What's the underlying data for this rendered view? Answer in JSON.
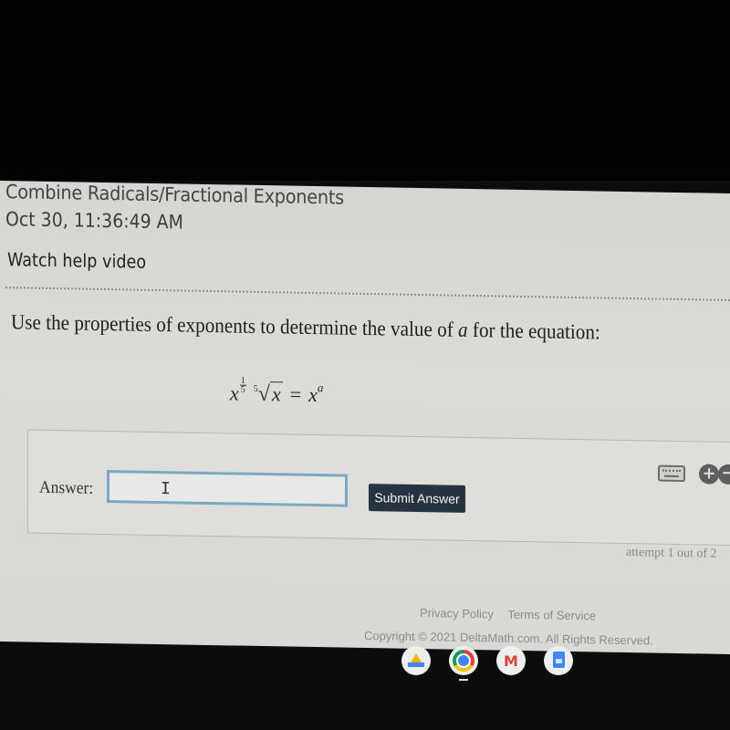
{
  "problem": {
    "topic": "Combine Radicals/Fractional Exponents",
    "timestamp": "Oct 30, 11:36:49 AM",
    "help_link": "Watch help video",
    "question_prefix": "Use the properties of exponents to determine the value of ",
    "question_variable": "a",
    "question_suffix": " for the equation:",
    "equation": {
      "base": "x",
      "exponent_numerator": "1",
      "exponent_denominator": "5",
      "root_index": "5",
      "radicand": "x",
      "equals": "=",
      "rhs_base": "x",
      "rhs_exponent": "a"
    }
  },
  "answer": {
    "label": "Answer:",
    "input_value": "",
    "cursor_glyph": "I",
    "submit_label": "Submit Answer",
    "attempt_text": "attempt 1 out of 2",
    "icons": [
      "keyboard-icon",
      "zoom-in-icon",
      "zoom-out-icon"
    ],
    "zoom_in_glyph": "+",
    "zoom_out_glyph": "−"
  },
  "footer": {
    "links": [
      "Privacy Policy",
      "Terms of Service"
    ],
    "copyright": "Copyright © 2021 DeltaMath.com. All Rights Reserved."
  },
  "shelf": {
    "apps": [
      "Google Drive",
      "Google Chrome",
      "Gmail",
      "Google Docs"
    ],
    "gmail_glyph": "M",
    "active_app": "Google Chrome"
  },
  "colors": {
    "submit_button": "#263340",
    "input_border": "#7aa9c4",
    "page_background": "#dcdbd7"
  }
}
